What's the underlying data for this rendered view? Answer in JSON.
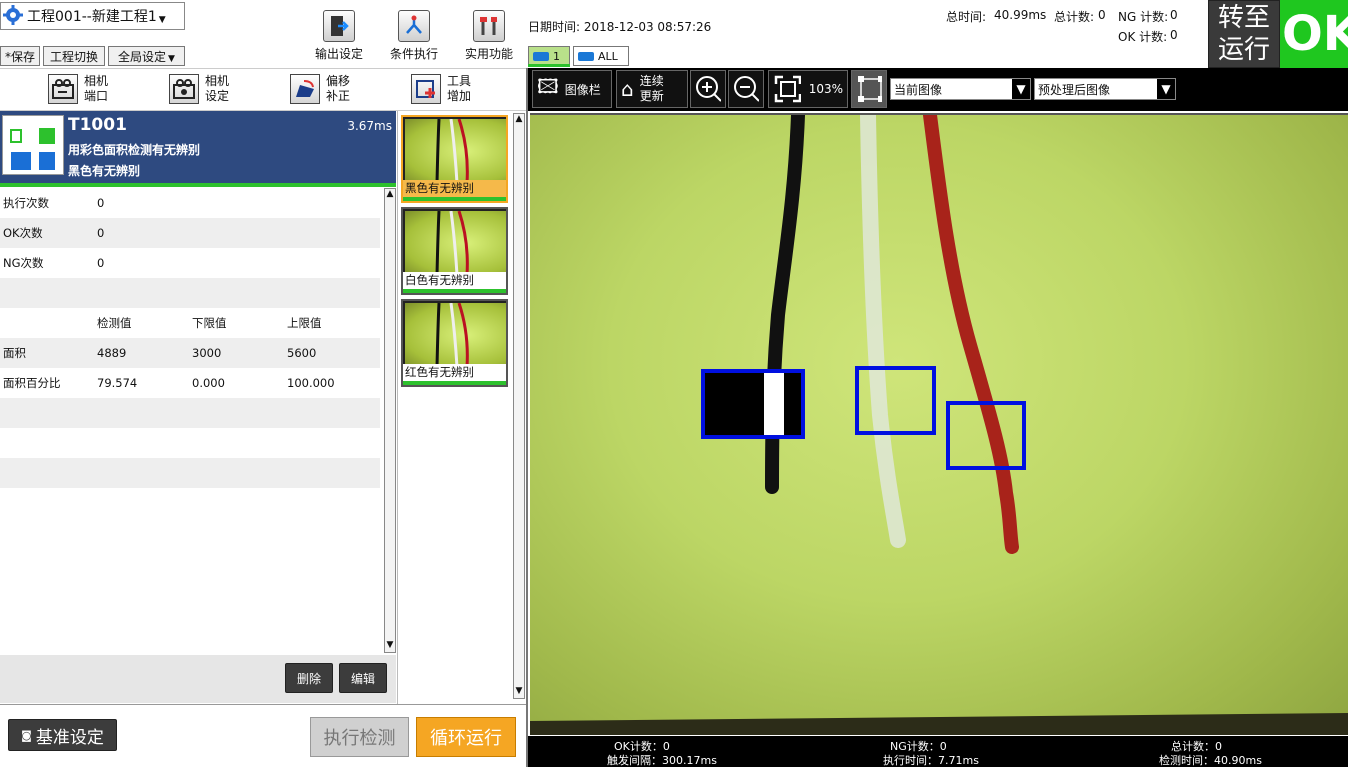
{
  "project": {
    "title": "工程001--新建工程1"
  },
  "top_buttons": {
    "save": "*保存",
    "switch": "工程切换",
    "global": "全局设定"
  },
  "toolbar": {
    "output": "输出设定",
    "condition": "条件执行",
    "utility": "实用功能"
  },
  "header": {
    "datetime": "日期时间: 2018-12-03 08:57:26",
    "total_time_label": "总时间:",
    "total_time": "40.99ms",
    "total_count_label": "总计数:",
    "total_count": "0",
    "ng_label": "NG 计数:",
    "ng_count": "0",
    "ok_label": "OK 计数:",
    "ok_count": "0",
    "run_line1": "转至",
    "run_line2": "运行",
    "ok_big": "OK",
    "cam_tab_1": "1",
    "cam_tab_all": "ALL"
  },
  "tools": {
    "cam_port_1": "相机",
    "cam_port_2": "端口",
    "cam_set_1": "相机",
    "cam_set_2": "设定",
    "offset_1": "偏移",
    "offset_2": "补正",
    "tool_add_1": "工具",
    "tool_add_2": "增加"
  },
  "task": {
    "id": "T1001",
    "time": "3.67ms",
    "line1": "用彩色面积检测有无辨别",
    "line2": "黑色有无辨别"
  },
  "table": [
    [
      "执行次数",
      "0",
      "",
      ""
    ],
    [
      "OK次数",
      "0",
      "",
      ""
    ],
    [
      "NG次数",
      "0",
      "",
      ""
    ],
    [
      "",
      "",
      "",
      ""
    ],
    [
      "",
      "检测值",
      "下限值",
      "上限值"
    ],
    [
      "面积",
      "4889",
      "3000",
      "5600"
    ],
    [
      "面积百分比",
      "79.574",
      "0.000",
      "100.000"
    ],
    [
      "",
      "",
      "",
      ""
    ],
    [
      "",
      "",
      "",
      ""
    ],
    [
      "",
      "",
      "",
      ""
    ]
  ],
  "actions": {
    "delete": "删除",
    "edit": "编辑"
  },
  "bottom": {
    "baseline": "基准设定",
    "exec": "执行检测",
    "loop": "循环运行"
  },
  "thumbnails": [
    "黑色有无辨别",
    "白色有无辨别",
    "红色有无辨别"
  ],
  "viewer_toolbar": {
    "gallery": "图像栏",
    "continuous_1": "连续",
    "continuous_2": "更新",
    "zoom": "103%",
    "combo1": "当前图像",
    "combo2": "预处理后图像"
  },
  "status": {
    "ok": "OK计数：0",
    "trigger": "触发间隔：300.17ms",
    "ng": "NG计数：0",
    "exec": "执行时间：7.71ms",
    "total": "总计数：0",
    "detect": "检测时间：40.90ms"
  },
  "colors": {
    "task_header": "#2e4a80",
    "ok_green": "#1fc71f",
    "loop_orange": "#f5a623",
    "roi_blue": "#0010e0"
  }
}
